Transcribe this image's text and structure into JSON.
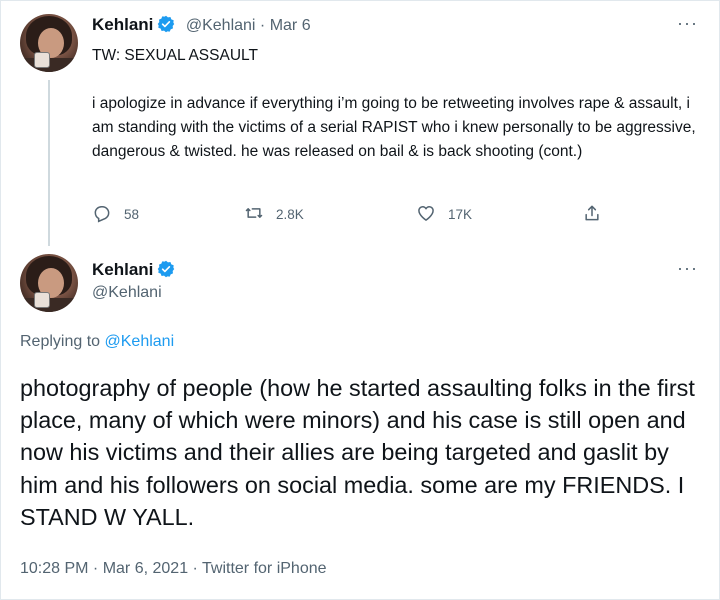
{
  "first_tweet": {
    "name": "Kehlani",
    "handle_date": "@Kehlani · Mar 6",
    "more": "···",
    "text_warning": "TW: SEXUAL ASSAULT",
    "text_body": "i apologize in advance if everything i’m going to be retweeting involves rape & assault, i am standing with the victims of a serial RAPIST who i knew personally to be aggressive, dangerous & twisted. he was released on bail & is back shooting (cont.)",
    "replies": "58",
    "retweets": "2.8K",
    "likes": "17K"
  },
  "second_tweet": {
    "name": "Kehlani",
    "handle": "@Kehlani",
    "more": "···",
    "replying_prefix": "Replying to",
    "replying_to": "@Kehlani",
    "text": "photography of people (how he started assaulting folks in the first place, many of which were minors) and his case is still open and now his victims and their allies are being targeted and gaslit by him and his followers on social media. some are my FRIENDS. I STAND W YALL.",
    "timestamp": "10:28 PM · Mar 6, 2021 · Twitter for iPhone"
  },
  "colors": {
    "verified": "#1d9bf0",
    "secondary_text": "#536471",
    "link": "#1d9bf0"
  },
  "icons": [
    "verified-badge-icon",
    "reply-icon",
    "retweet-icon",
    "like-icon",
    "share-icon",
    "more-icon"
  ]
}
